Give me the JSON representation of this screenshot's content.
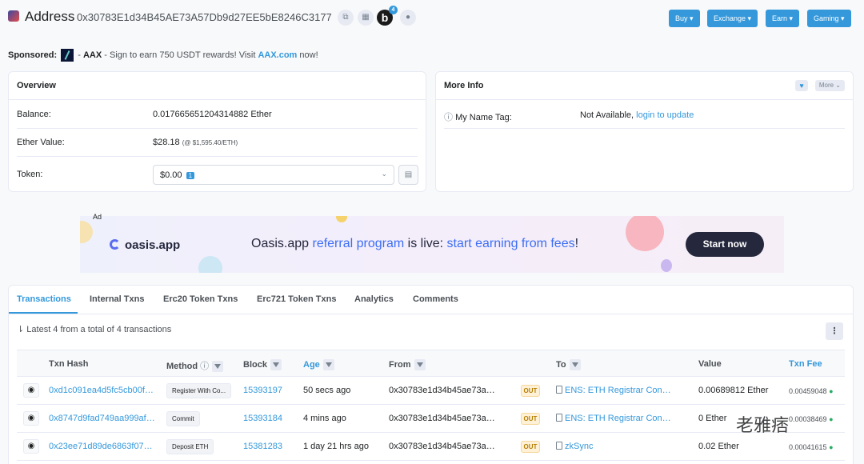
{
  "header": {
    "title": "Address",
    "address": "0x30783E1d34B45AE73A57Db9d27EE5bE8246C3177",
    "badge_count": "4",
    "b_label": "b",
    "buttons": [
      "Buy",
      "Exchange",
      "Earn",
      "Gaming"
    ]
  },
  "sponsored": {
    "label": "Sponsored:",
    "brand": "AAX",
    "text": " - Sign to earn 750 USDT rewards! Visit ",
    "link": "AAX.com",
    "tail": " now!"
  },
  "overview": {
    "title": "Overview",
    "balance_label": "Balance:",
    "balance_value": "0.017665651204314882 Ether",
    "ether_value_label": "Ether Value:",
    "ether_value": "$28.18",
    "ether_rate": "(@ $1,595.40/ETH)",
    "token_label": "Token:",
    "token_value": "$0.00",
    "token_count": "1"
  },
  "more_info": {
    "title": "More Info",
    "more_label": "More",
    "name_tag_label": "My Name Tag:",
    "name_tag_value": "Not Available,",
    "name_tag_link": "login to update"
  },
  "ad": {
    "tag": "Ad",
    "brand": "oasis.app",
    "text_a": "Oasis.app ",
    "text_b": "referral program",
    "text_c": " is live: ",
    "text_d": "start earning from fees",
    "text_e": "!",
    "cta": "Start now"
  },
  "tabs": [
    "Transactions",
    "Internal Txns",
    "Erc20 Token Txns",
    "Erc721 Token Txns",
    "Analytics",
    "Comments"
  ],
  "txn_summary": "Latest 4 from a total of 4 transactions",
  "columns": [
    "Txn Hash",
    "Method",
    "Block",
    "Age",
    "From",
    "To",
    "Value",
    "Txn Fee"
  ],
  "rows": [
    {
      "hash": "0xd1c091ea4d5fc5cb00f…",
      "method": "Register With Co...",
      "block": "15393197",
      "age": "50 secs ago",
      "from": "0x30783e1d34b45ae73a…",
      "dir": "OUT",
      "to": "ENS: ETH Registrar Con…",
      "value": "0.00689812 Ether",
      "fee": "0.00459048"
    },
    {
      "hash": "0x8747d9fad749aa999af…",
      "method": "Commit",
      "block": "15393184",
      "age": "4 mins ago",
      "from": "0x30783e1d34b45ae73a…",
      "dir": "OUT",
      "to": "ENS: ETH Registrar Con…",
      "value": "0 Ether",
      "fee": "0.00038469"
    },
    {
      "hash": "0x23ee71d89de6863f07…",
      "method": "Deposit ETH",
      "block": "15381283",
      "age": "1 day 21 hrs ago",
      "from": "0x30783e1d34b45ae73a…",
      "dir": "OUT",
      "to": "zkSync",
      "value": "0.02 Ether",
      "fee": "0.00041615"
    }
  ],
  "watermark": "老雅痞"
}
